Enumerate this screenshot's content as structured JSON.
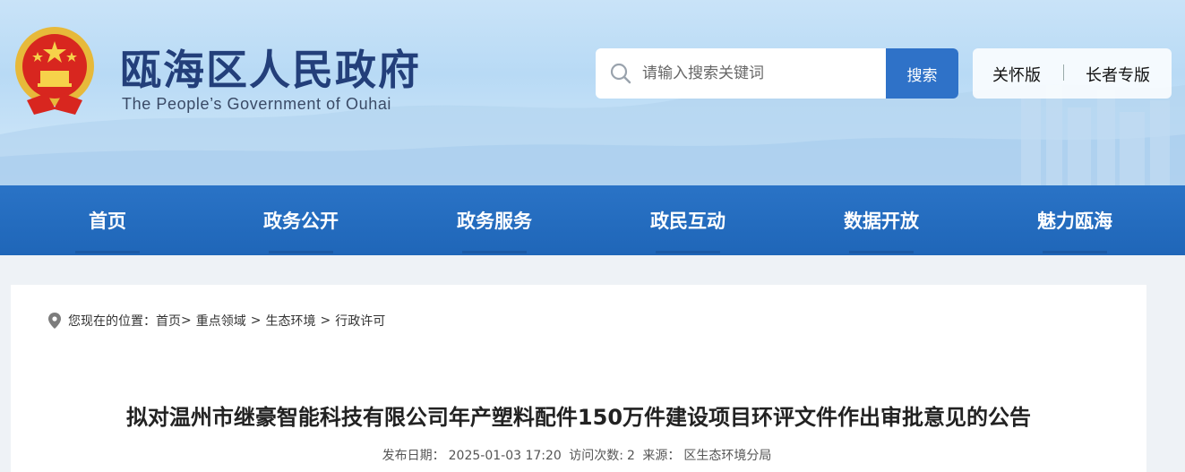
{
  "header": {
    "site_title": "瓯海区人民政府",
    "site_subtitle": "The People’s Government of Ouhai",
    "search": {
      "placeholder": "请输入搜索关键词",
      "button_label": "搜索"
    },
    "modes": {
      "care_label": "关怀版",
      "elder_label": "长者专版"
    }
  },
  "nav": {
    "items": [
      {
        "label": "首页"
      },
      {
        "label": "政务公开"
      },
      {
        "label": "政务服务"
      },
      {
        "label": "政民互动"
      },
      {
        "label": "数据开放"
      },
      {
        "label": "魅力瓯海"
      }
    ]
  },
  "breadcrumb": {
    "prefix": "您现在的位置：",
    "items": [
      "首页",
      "重点领域",
      "生态环境",
      "行政许可"
    ],
    "separator": ">"
  },
  "article": {
    "title": "拟对温州市继豪智能科技有限公司年产塑料配件150万件建设项目环评文件作出审批意见的公告",
    "publish_label": "发布日期：",
    "publish_date": "2025-01-03 17:20",
    "visits_label": "访问次数:",
    "visits": "2",
    "source_label": "来源：",
    "source": "区生态环境分局"
  },
  "colors": {
    "brand_blue": "#2f72c8",
    "nav_blue": "#2a73c6",
    "title_navy": "#233f7a"
  },
  "icons": {
    "emblem": "national-emblem-icon",
    "search": "search-icon",
    "location": "location-pin-icon"
  }
}
